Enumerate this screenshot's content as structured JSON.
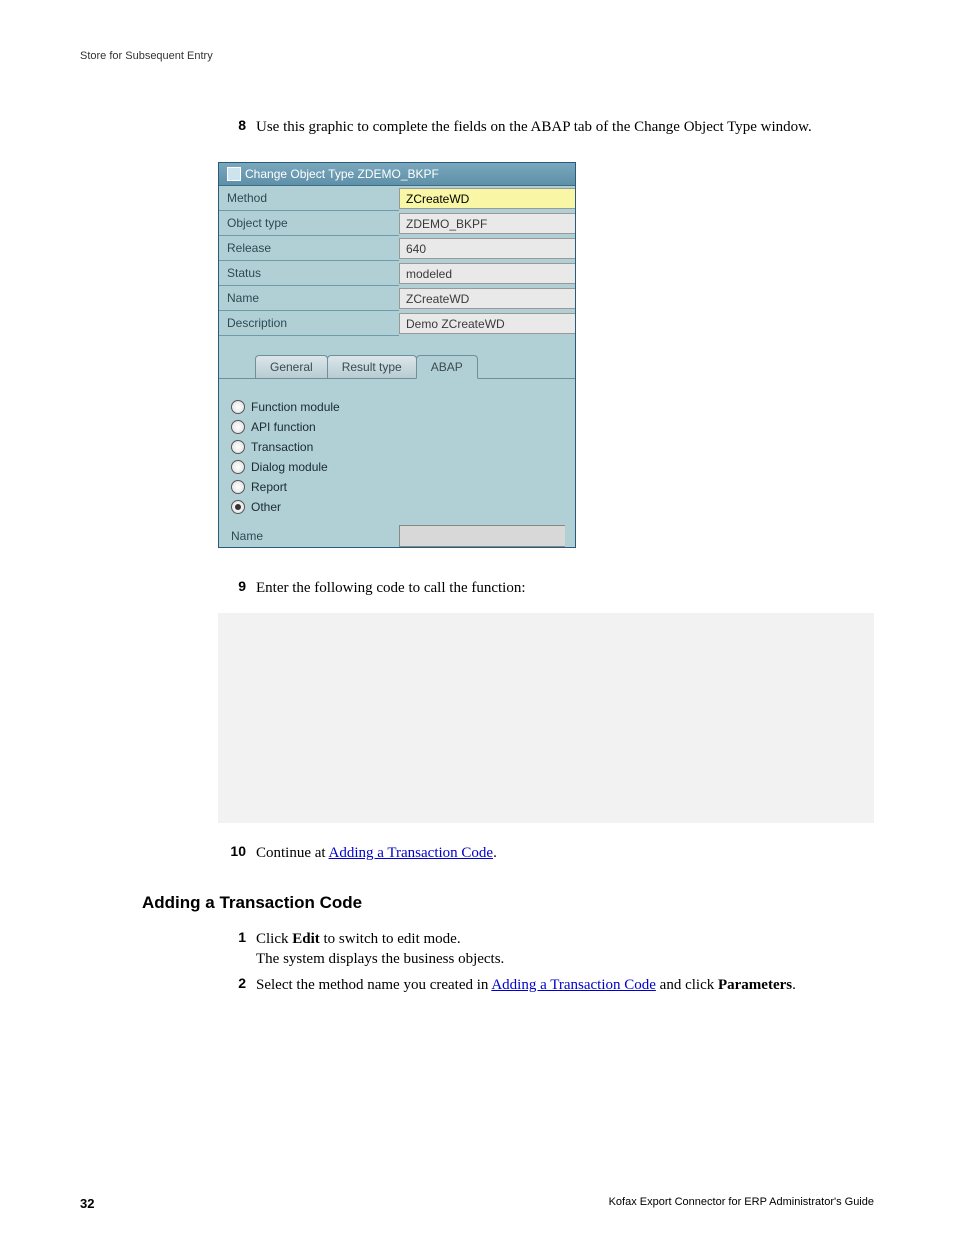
{
  "header": "Store for Subsequent Entry",
  "steps_a": [
    {
      "n": "8",
      "html": "Use this graphic to complete the fields on the ABAP tab of the Change Object Type window."
    }
  ],
  "sap": {
    "title": "Change Object Type ZDEMO_BKPF",
    "rows": [
      {
        "label": "Method",
        "value": "ZCreateWD",
        "hl": true
      },
      {
        "label": "Object type",
        "value": "ZDEMO_BKPF"
      },
      {
        "label": "Release",
        "value": "640"
      },
      {
        "label": "Status",
        "value": "modeled"
      },
      {
        "label": "Name",
        "value": "ZCreateWD"
      },
      {
        "label": "Description",
        "value": "Demo ZCreateWD"
      }
    ],
    "tabs": [
      "General",
      "Result type",
      "ABAP"
    ],
    "active_tab": 2,
    "radios": [
      {
        "label": "Function module",
        "sel": false
      },
      {
        "label": "API function",
        "sel": false
      },
      {
        "label": "Transaction",
        "sel": false
      },
      {
        "label": "Dialog module",
        "sel": false
      },
      {
        "label": "Report",
        "sel": false
      },
      {
        "label": "Other",
        "sel": true
      }
    ],
    "name_label": "Name"
  },
  "step9": {
    "n": "9",
    "text": "Enter the following code to call the function:"
  },
  "step10": {
    "n": "10",
    "pre": "Continue at ",
    "link": "Adding a Transaction Code",
    "post": "."
  },
  "section_heading": "Adding a Transaction Code",
  "steps_b": [
    {
      "n": "1",
      "l1_pre": "Click ",
      "l1_b": "Edit",
      "l1_post": " to switch to edit mode.",
      "l2": "The system displays the business objects."
    },
    {
      "n": "2",
      "pre": "Select the method name you created in ",
      "link": "Adding a Transaction Code",
      "mid": " and click ",
      "b": "Parameters",
      "post": "."
    }
  ],
  "footer": {
    "page": "32",
    "title": "Kofax Export Connector for ERP Administrator's Guide"
  }
}
